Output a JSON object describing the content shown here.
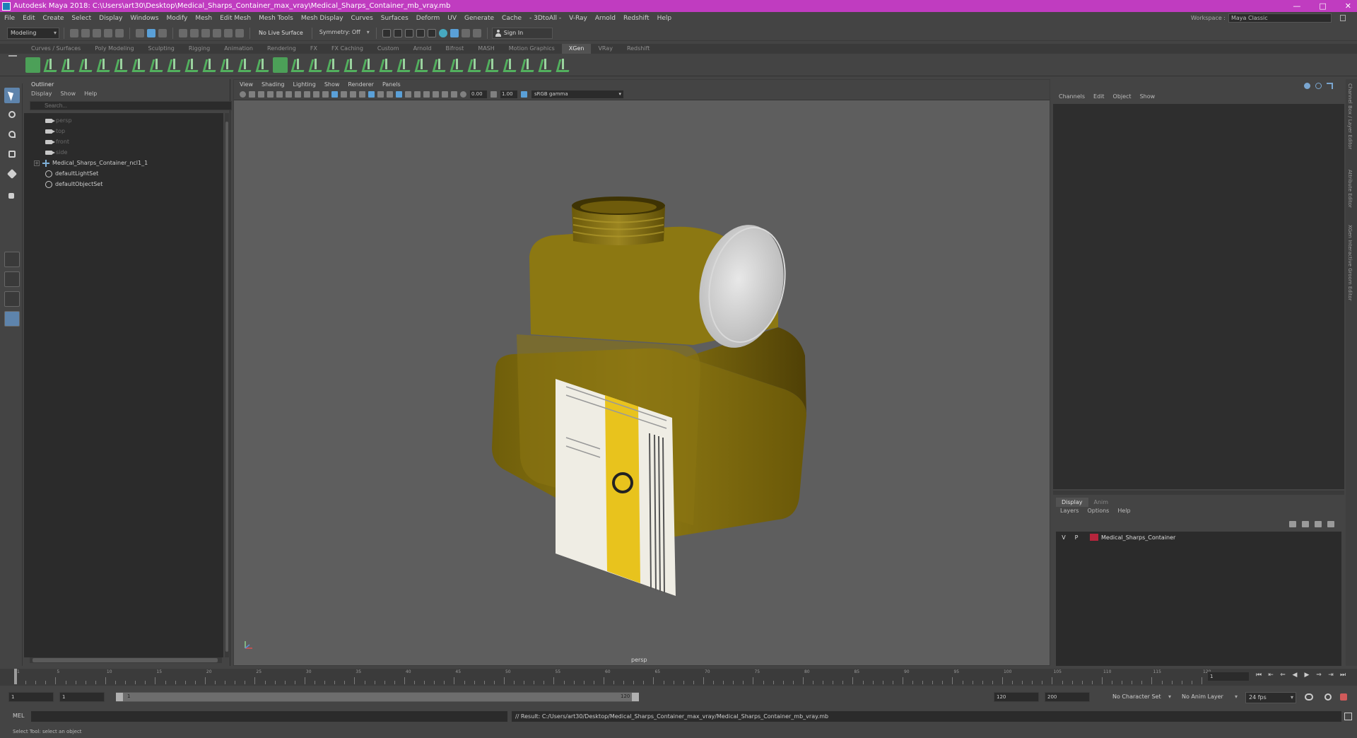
{
  "window": {
    "title": "Autodesk Maya 2018: C:\\Users\\art30\\Desktop\\Medical_Sharps_Container_max_vray\\Medical_Sharps_Container_mb_vray.mb",
    "controls": [
      "—",
      "□",
      "✕"
    ]
  },
  "menubar": {
    "items": [
      "File",
      "Edit",
      "Create",
      "Select",
      "Display",
      "Windows",
      "Modify",
      "Mesh",
      "Edit Mesh",
      "Mesh Tools",
      "Mesh Display",
      "Curves",
      "Surfaces",
      "Deform",
      "UV",
      "Generate",
      "Cache",
      "- 3DtoAll -",
      "V-Ray",
      "Arnold",
      "Redshift",
      "Help"
    ],
    "workspace_label": "Workspace :",
    "workspace_value": "Maya Classic"
  },
  "statusline": {
    "mode": "Modeling",
    "live_surface": "No Live Surface",
    "symmetry": "Symmetry: Off",
    "signin": "Sign In"
  },
  "shelf": {
    "tabs": [
      "Curves / Surfaces",
      "Poly Modeling",
      "Sculpting",
      "Rigging",
      "Animation",
      "Rendering",
      "FX",
      "FX Caching",
      "Custom",
      "Arnold",
      "Bifrost",
      "MASH",
      "Motion Graphics",
      "XGen",
      "VRay",
      "Redshift"
    ],
    "active_tab": "XGen"
  },
  "outliner": {
    "title": "Outliner",
    "menu": [
      "Display",
      "Show",
      "Help"
    ],
    "search_placeholder": "Search...",
    "cameras": [
      "persp",
      "top",
      "front",
      "side"
    ],
    "group": "Medical_Sharps_Container_ncl1_1",
    "sets": [
      "defaultLightSet",
      "defaultObjectSet"
    ]
  },
  "viewport": {
    "menu": [
      "View",
      "Shading",
      "Lighting",
      "Show",
      "Renderer",
      "Panels"
    ],
    "exposure": "0.00",
    "gamma": "1.00",
    "colorspace": "sRGB gamma",
    "camera": "persp"
  },
  "channelbox": {
    "menu": [
      "Channels",
      "Edit",
      "Object",
      "Show"
    ]
  },
  "layers": {
    "tabs": [
      "Display",
      "Anim"
    ],
    "menu": [
      "Layers",
      "Options",
      "Help"
    ],
    "rows": [
      {
        "v": "V",
        "p": "P",
        "color": "#b5253c",
        "name": "Medical_Sharps_Container"
      }
    ]
  },
  "sidestrip": {
    "labels": [
      "Channel Box / Layer Editor",
      "Attribute Editor",
      "XGen Interactive Groom Editor"
    ]
  },
  "timeline": {
    "tick_labels": [
      "1",
      "5",
      "10",
      "15",
      "20",
      "25",
      "30",
      "35",
      "40",
      "45",
      "50",
      "55",
      "60",
      "65",
      "70",
      "75",
      "80",
      "85",
      "90",
      "95",
      "100",
      "105",
      "110",
      "115",
      "120"
    ],
    "current_frame": "1"
  },
  "range": {
    "start": "1",
    "playback_start": "1",
    "range_start_label": "1",
    "range_end_label": "120",
    "playback_end": "120",
    "end": "200",
    "character_set": "No Character Set",
    "anim_layer": "No Anim Layer",
    "fps": "24 fps"
  },
  "cmdline": {
    "label": "MEL",
    "result": "// Result: C:/Users/art30/Desktop/Medical_Sharps_Container_max_vray/Medical_Sharps_Container_mb_vray.mb"
  },
  "helpline": {
    "text": "Select Tool: select an object"
  }
}
